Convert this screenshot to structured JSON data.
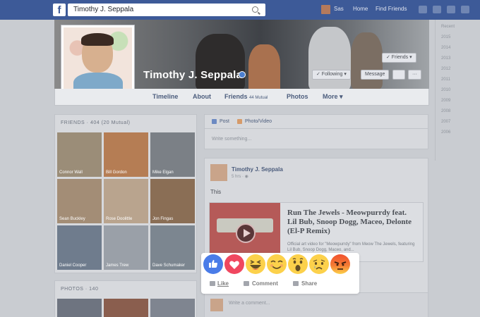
{
  "topbar": {
    "logo": "f",
    "search_value": "Timothy J. Seppala",
    "nav": {
      "user": "Sas",
      "home": "Home",
      "find_friends": "Find Friends"
    }
  },
  "profile": {
    "name": "Timothy J. Seppala",
    "cover_buttons": {
      "friends": "✓ Friends ▾",
      "following": "✓ Following ▾",
      "message": "Message",
      "more": "···"
    },
    "tabs": [
      {
        "label": "Timeline"
      },
      {
        "label": "About"
      },
      {
        "label": "Friends",
        "count": "44 Mutual"
      },
      {
        "label": "Photos"
      },
      {
        "label": "More ▾"
      }
    ]
  },
  "friends_box": {
    "title": "FRIENDS · 404 (20 Mutual)",
    "friends": [
      {
        "name": "Connor Wall"
      },
      {
        "name": "Bill Gordon"
      },
      {
        "name": "Mike Elgan"
      },
      {
        "name": "Sean Buckley"
      },
      {
        "name": "Rose Doolittle"
      },
      {
        "name": "Jon Fingas"
      },
      {
        "name": "Daniel Cooper"
      },
      {
        "name": "James Trew"
      },
      {
        "name": "Dave Schumaker"
      }
    ]
  },
  "photos_box": {
    "title": "PHOTOS · 140"
  },
  "composer": {
    "tab_post": "Post",
    "tab_photo": "Photo/Video",
    "placeholder": "Write something..."
  },
  "post": {
    "author": "Timothy J. Seppala",
    "meta": "5 hrs · ◉",
    "text": "This",
    "link_title": "Run The Jewels - Meowpurrdy feat. Lil Bub, Snoop Dogg, Maceo, Delonte (El-P Remix)",
    "link_desc": "Official art video for \"Meowpurrdy\" from Meow The Jewels, featuring Lil Bub, Snoop Dogg, Maceo, and...",
    "comment_placeholder": "Write a comment..."
  },
  "years": [
    "Recent",
    "2015",
    "2014",
    "2013",
    "2012",
    "2011",
    "2010",
    "2009",
    "2008",
    "2007",
    "2006"
  ],
  "reactions": {
    "items": [
      "like-icon",
      "love-icon",
      "haha-icon",
      "yay-icon",
      "wow-icon",
      "sad-icon",
      "angry-icon"
    ],
    "like_label": "Like",
    "comment_label": "Comment",
    "share_label": "Share"
  }
}
